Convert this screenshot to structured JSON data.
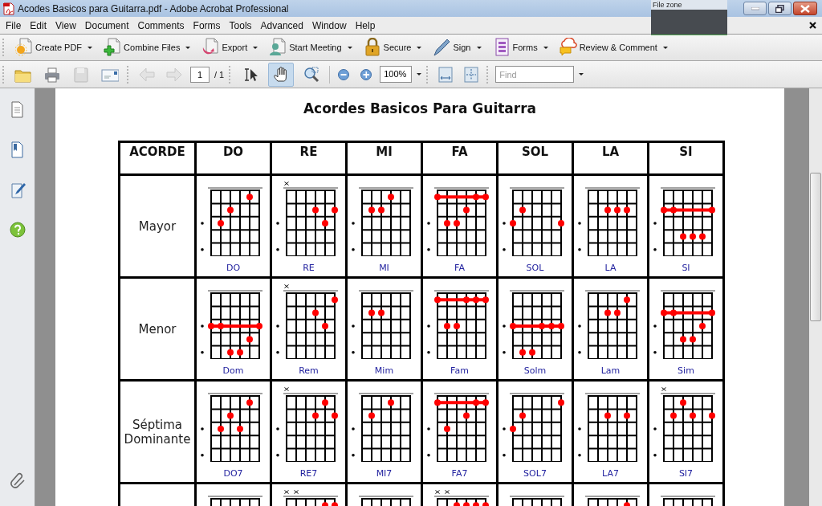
{
  "window": {
    "title": "Acodes Basicos para Guitarra.pdf - Adobe Acrobat Professional"
  },
  "file_zone": {
    "label": "File zone"
  },
  "menu": [
    "File",
    "Edit",
    "View",
    "Document",
    "Comments",
    "Forms",
    "Tools",
    "Advanced",
    "Window",
    "Help"
  ],
  "task_toolbar": [
    {
      "label": "Create PDF"
    },
    {
      "label": "Combine Files"
    },
    {
      "label": "Export"
    },
    {
      "label": "Start Meeting"
    },
    {
      "label": "Secure"
    },
    {
      "label": "Sign"
    },
    {
      "label": "Forms"
    },
    {
      "label": "Review & Comment"
    }
  ],
  "nav_toolbar": {
    "page": "1",
    "page_count": "/ 1",
    "tools": [
      {
        "selected": false
      },
      {
        "selected": true
      },
      {
        "selected": false
      }
    ],
    "zoom": "100%",
    "find_placeholder": "Find"
  },
  "document": {
    "title": "Acordes Basicos Para Guitarra",
    "columns": [
      "ACORDE",
      "DO",
      "RE",
      "MI",
      "FA",
      "SOL",
      "LA",
      "SI"
    ],
    "rows": [
      {
        "label": "Mayor",
        "chords": [
          {
            "name": "DO"
          },
          {
            "name": "RE"
          },
          {
            "name": "MI"
          },
          {
            "name": "FA"
          },
          {
            "name": "SOL"
          },
          {
            "name": "LA"
          },
          {
            "name": "SI"
          }
        ]
      },
      {
        "label": "Menor",
        "chords": [
          {
            "name": "Dom"
          },
          {
            "name": "Rem"
          },
          {
            "name": "Mim"
          },
          {
            "name": "Fam"
          },
          {
            "name": "Solm"
          },
          {
            "name": "Lam"
          },
          {
            "name": "Sim"
          }
        ]
      },
      {
        "label": "Séptima Dominante",
        "chords": [
          {
            "name": "DO7"
          },
          {
            "name": "RE7"
          },
          {
            "name": "MI7"
          },
          {
            "name": "FA7"
          },
          {
            "name": "SOL7"
          },
          {
            "name": "LA7"
          },
          {
            "name": "SI7"
          }
        ]
      }
    ]
  }
}
